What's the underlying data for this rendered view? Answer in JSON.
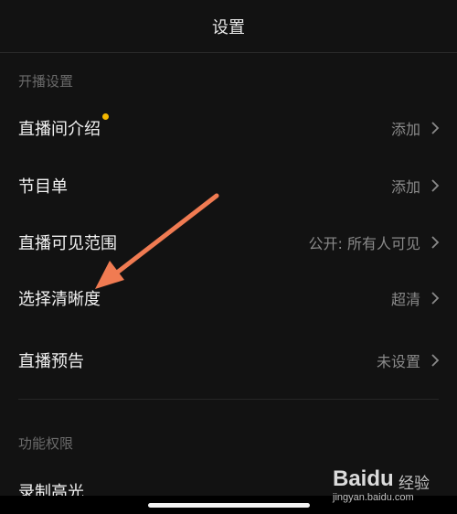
{
  "header": {
    "title": "设置"
  },
  "sections": [
    {
      "label": "开播设置",
      "items": [
        {
          "label": "直播间介绍",
          "value": "添加",
          "dot": true
        },
        {
          "label": "节目单",
          "value": "添加"
        },
        {
          "label": "直播可见范围",
          "value": "公开: 所有人可见"
        },
        {
          "label": "选择清晰度",
          "value": "超清"
        },
        {
          "label": "直播预告",
          "value": "未设置"
        }
      ]
    },
    {
      "label": "功能权限",
      "items": [
        {
          "label": "录制高光"
        }
      ]
    }
  ],
  "annotation": {
    "color": "#f07b52"
  },
  "watermark": {
    "brand": "Baidu",
    "suffix": "经验",
    "url": "jingyan.baidu.com"
  },
  "colors": {
    "background": "#121212",
    "dot": "#f5b800"
  }
}
